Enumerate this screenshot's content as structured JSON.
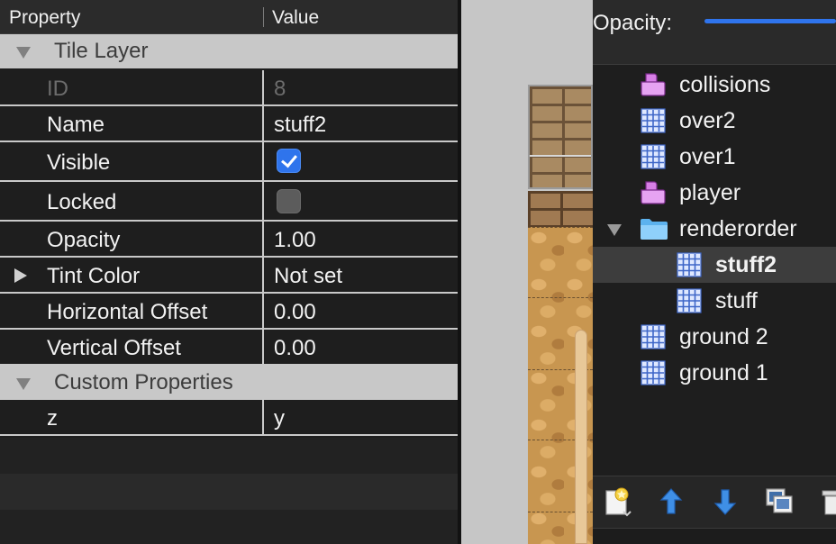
{
  "properties": {
    "header": {
      "property": "Property",
      "value": "Value"
    },
    "group_tile_layer": "Tile Layer",
    "rows": {
      "id": {
        "name": "ID",
        "value": "8"
      },
      "name": {
        "name": "Name",
        "value": "stuff2"
      },
      "visible": {
        "name": "Visible",
        "checked": true
      },
      "locked": {
        "name": "Locked",
        "checked": false
      },
      "opacity": {
        "name": "Opacity",
        "value": "1.00"
      },
      "tint": {
        "name": "Tint Color",
        "value": "Not set"
      },
      "hoffset": {
        "name": "Horizontal Offset",
        "value": "0.00"
      },
      "voffset": {
        "name": "Vertical Offset",
        "value": "0.00"
      }
    },
    "group_custom": "Custom Properties",
    "custom": {
      "name": "z",
      "value": "y"
    }
  },
  "layers_panel": {
    "opacity_label": "Opacity:",
    "opacity_fraction": 1.0,
    "accent_color": "#2f74ec",
    "layers": [
      {
        "name": "collisions",
        "icon": "object-layer-icon"
      },
      {
        "name": "over2",
        "icon": "tile-layer-icon"
      },
      {
        "name": "over1",
        "icon": "tile-layer-icon"
      },
      {
        "name": "player",
        "icon": "object-layer-icon"
      },
      {
        "name": "renderorder",
        "icon": "folder-icon",
        "expanded": true
      },
      {
        "name": "stuff2",
        "icon": "tile-layer-icon",
        "selected": true
      },
      {
        "name": "stuff",
        "icon": "tile-layer-icon"
      },
      {
        "name": "ground 2",
        "icon": "tile-layer-icon"
      },
      {
        "name": "ground 1",
        "icon": "tile-layer-icon"
      }
    ],
    "toolbar_icons": [
      "new-layer-icon",
      "raise-layer-icon",
      "lower-layer-icon",
      "duplicate-layer-icon",
      "delete-layer-icon"
    ]
  }
}
